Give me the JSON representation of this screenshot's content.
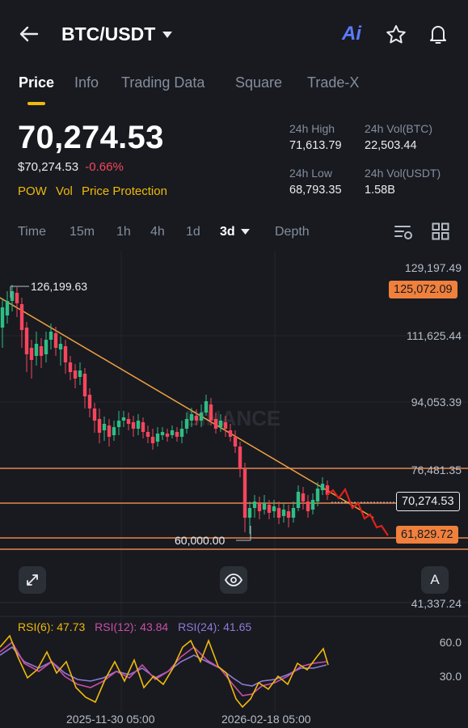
{
  "header": {
    "pair": "BTC/USDT",
    "ai_label": "Ai"
  },
  "tabs": [
    {
      "label": "Price",
      "active": true
    },
    {
      "label": "Info"
    },
    {
      "label": "Trading Data"
    },
    {
      "label": "Square"
    },
    {
      "label": "Trade-X"
    }
  ],
  "ticker": {
    "last_price": "70,274.53",
    "usd_price": "$70,274.53",
    "change": "-0.66%",
    "badges": [
      "POW",
      "Vol",
      "Price Protection"
    ],
    "high_label": "24h High",
    "high": "71,613.79",
    "low_label": "24h Low",
    "low": "68,793.35",
    "vol_btc_label": "24h Vol(BTC)",
    "vol_btc": "22,503.44",
    "vol_usdt_label": "24h Vol(USDT)",
    "vol_usdt": "1.58B"
  },
  "timeframes": [
    "Time",
    "15m",
    "1h",
    "4h",
    "1d",
    "3d",
    "Depth"
  ],
  "active_timeframe": "3d",
  "chart": {
    "watermark": "BINANCE",
    "y_labels": [
      "129,197.49",
      "111,625.44",
      "94,053.39",
      "76,481.35",
      "41,337.24"
    ],
    "tag_top": "125,072.09",
    "tag_current": "70,274.53",
    "tag_bottom": "61,829.72",
    "high_marker": "126,199.63",
    "low_marker": "60,000.00",
    "a_button": "A"
  },
  "rsi": {
    "rsi6": "RSI(6): 47.73",
    "rsi12": "RSI(12): 43.84",
    "rsi24": "RSI(24): 41.65",
    "level_60": "60.0",
    "level_30": "30.0"
  },
  "x_labels": [
    "2025-11-30 05:00",
    "2026-02-18 05:00"
  ],
  "colors": {
    "up": "#2ebd85",
    "down": "#f6465d",
    "accent": "#f0b90b",
    "orange": "#f7931a",
    "bg": "#181a20"
  }
}
